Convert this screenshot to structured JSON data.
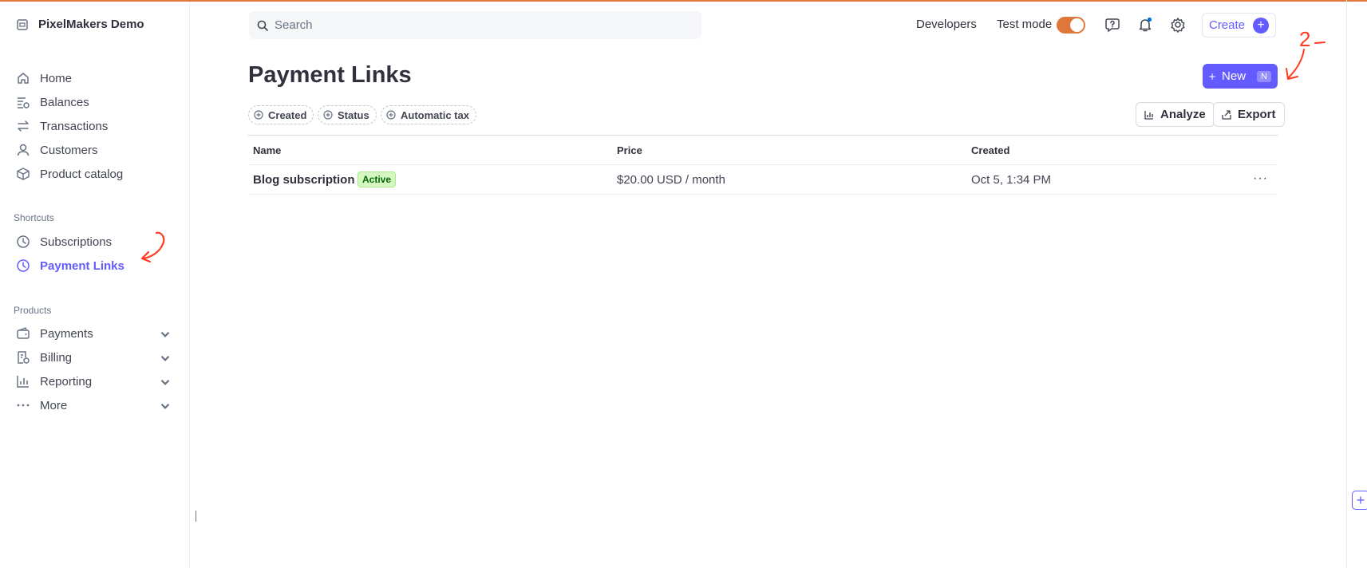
{
  "account": {
    "name": "PixelMakers Demo"
  },
  "sidebar": {
    "main_items": [
      {
        "label": "Home",
        "icon": "home-icon"
      },
      {
        "label": "Balances",
        "icon": "balances-icon"
      },
      {
        "label": "Transactions",
        "icon": "transactions-icon"
      },
      {
        "label": "Customers",
        "icon": "customers-icon"
      },
      {
        "label": "Product catalog",
        "icon": "product-catalog-icon"
      }
    ],
    "shortcuts_label": "Shortcuts",
    "shortcuts": [
      {
        "label": "Subscriptions",
        "icon": "clock-icon"
      },
      {
        "label": "Payment Links",
        "icon": "clock-icon",
        "active": true
      }
    ],
    "products_label": "Products",
    "products": [
      {
        "label": "Payments",
        "icon": "wallet-icon"
      },
      {
        "label": "Billing",
        "icon": "billing-icon"
      },
      {
        "label": "Reporting",
        "icon": "reporting-icon"
      },
      {
        "label": "More",
        "icon": "dots-icon"
      }
    ]
  },
  "topbar": {
    "search_placeholder": "Search",
    "developers": "Developers",
    "test_mode": "Test mode",
    "test_mode_on": true,
    "create": "Create"
  },
  "page": {
    "title": "Payment Links",
    "new_button": "New",
    "new_shortcut": "N",
    "filters": [
      "Created",
      "Status",
      "Automatic tax"
    ],
    "analyze": "Analyze",
    "export": "Export"
  },
  "table": {
    "headers": {
      "name": "Name",
      "price": "Price",
      "created": "Created"
    },
    "rows": [
      {
        "name": "Blog subscription",
        "status": "Active",
        "price": "$20.00 USD / month",
        "created": "Oct 5, 1:34 PM"
      }
    ]
  },
  "annotations": {
    "step2": "2"
  },
  "colors": {
    "accent": "#635bff",
    "test_mode": "#e0773a",
    "active_badge_bg": "#d7f7c2",
    "active_badge_text": "#006908",
    "annotation": "#ff3b1f"
  }
}
